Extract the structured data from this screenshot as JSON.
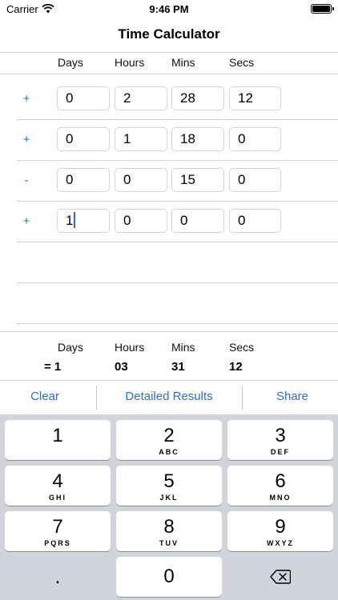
{
  "status_bar": {
    "carrier": "Carrier",
    "time": "9:46 PM"
  },
  "nav": {
    "title": "Time Calculator"
  },
  "columns": [
    "Days",
    "Hours",
    "Mins",
    "Secs"
  ],
  "rows": [
    {
      "op": "+",
      "values": [
        "0",
        "2",
        "28",
        "12"
      ]
    },
    {
      "op": "+",
      "values": [
        "0",
        "1",
        "18",
        "0"
      ]
    },
    {
      "op": "-",
      "values": [
        "0",
        "0",
        "15",
        "0"
      ]
    },
    {
      "op": "+",
      "values": [
        "1",
        "0",
        "0",
        "0"
      ]
    }
  ],
  "result": {
    "headers": [
      "Days",
      "Hours",
      "Mins",
      "Secs"
    ],
    "values": [
      "= 1",
      "03",
      "31",
      "12"
    ]
  },
  "actions": {
    "clear": "Clear",
    "detailed": "Detailed Results",
    "share": "Share"
  },
  "keyboard": {
    "keys": [
      {
        "digit": "1",
        "letters": ""
      },
      {
        "digit": "2",
        "letters": "ABC"
      },
      {
        "digit": "3",
        "letters": "DEF"
      },
      {
        "digit": "4",
        "letters": "GHI"
      },
      {
        "digit": "5",
        "letters": "JKL"
      },
      {
        "digit": "6",
        "letters": "MNO"
      },
      {
        "digit": "7",
        "letters": "PQRS"
      },
      {
        "digit": "8",
        "letters": "TUV"
      },
      {
        "digit": "9",
        "letters": "WXYZ"
      }
    ],
    "dot": ".",
    "zero": "0",
    "delete_icon": "backspace-icon"
  },
  "colors": {
    "accent": "#2a6fd6",
    "keyboard_bg": "#d1d4da"
  }
}
